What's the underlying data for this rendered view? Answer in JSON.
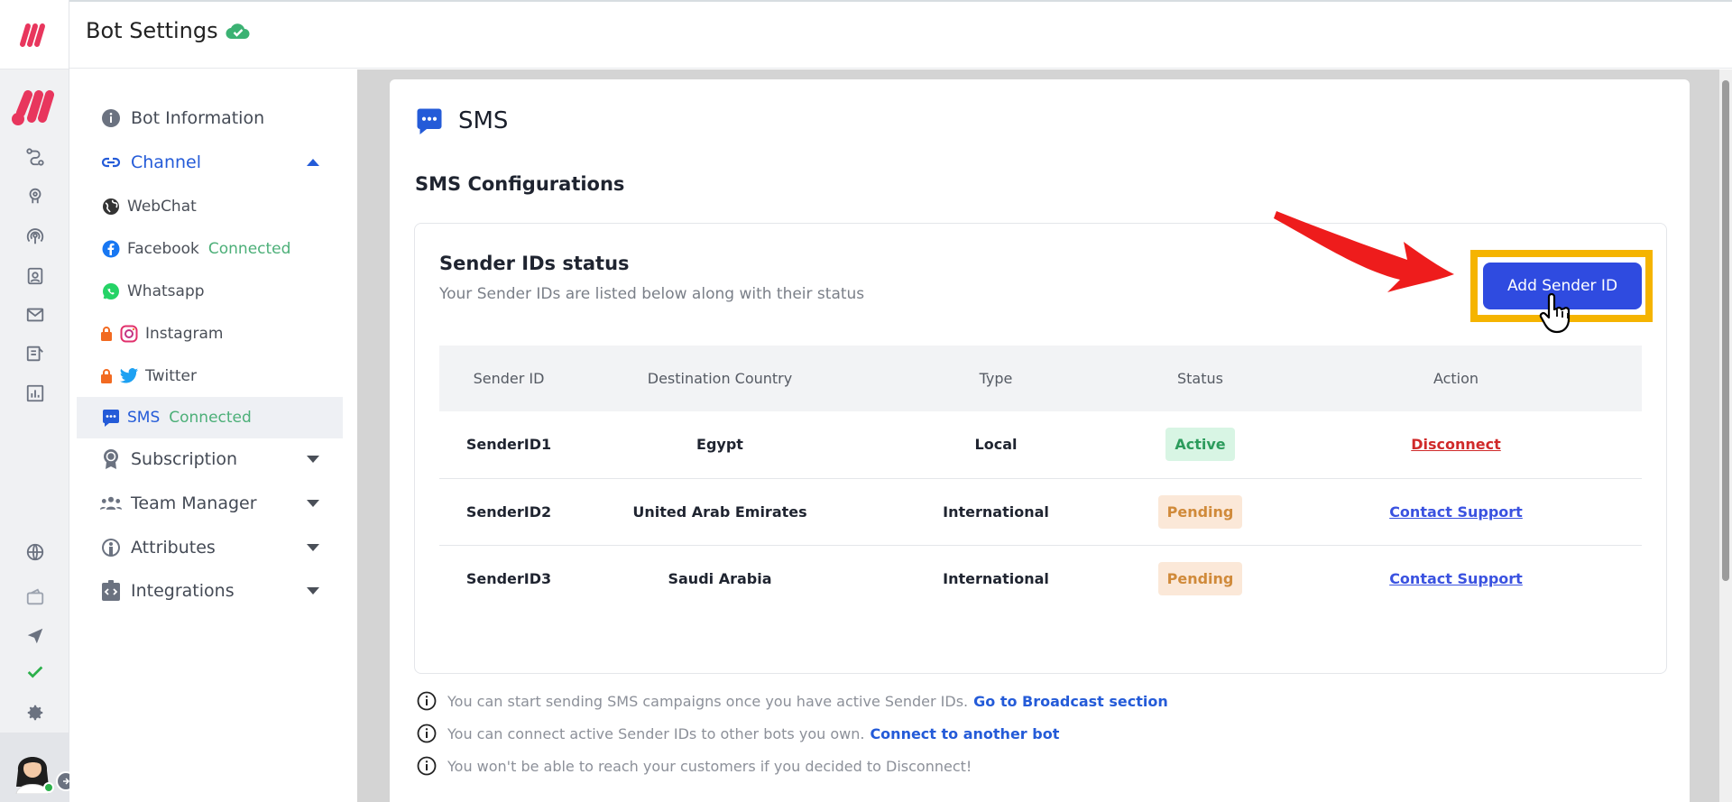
{
  "header": {
    "title": "Bot Settings",
    "saved_icon": "cloud-check-icon"
  },
  "settings_nav": {
    "bot_information": "Bot Information",
    "channel": "Channel",
    "channels": [
      {
        "label": "WebChat",
        "icon": "globe-icon",
        "status": ""
      },
      {
        "label": "Facebook",
        "icon": "facebook-icon",
        "status": "Connected"
      },
      {
        "label": "Whatsapp",
        "icon": "whatsapp-icon",
        "status": ""
      },
      {
        "label": "Instagram",
        "icon": "instagram-icon",
        "status": "",
        "locked": true
      },
      {
        "label": "Twitter",
        "icon": "twitter-icon",
        "status": "",
        "locked": true
      },
      {
        "label": "SMS",
        "icon": "sms-chat-icon",
        "status": "Connected",
        "active": true
      }
    ],
    "subscription": "Subscription",
    "team_manager": "Team Manager",
    "attributes": "Attributes",
    "integrations": "Integrations"
  },
  "card": {
    "title": "SMS",
    "section_title": "SMS Configurations",
    "panel": {
      "title": "Sender IDs status",
      "subtitle": "Your Sender IDs are listed below along with their status",
      "add_button": "Add Sender ID"
    },
    "table": {
      "headers": [
        "Sender ID",
        "Destination Country",
        "Type",
        "Status",
        "Action"
      ],
      "rows": [
        {
          "sender_id": "SenderID1",
          "country": "Egypt",
          "type": "Local",
          "status": "Active",
          "action": "Disconnect"
        },
        {
          "sender_id": "SenderID2",
          "country": "United Arab Emirates",
          "type": "International",
          "status": "Pending",
          "action": "Contact Support"
        },
        {
          "sender_id": "SenderID3",
          "country": "Saudi Arabia",
          "type": "International",
          "status": "Pending",
          "action": "Contact Support"
        }
      ]
    },
    "notes": [
      {
        "text": "You can start sending SMS campaigns once you have active Sender IDs.",
        "link": "Go to Broadcast section"
      },
      {
        "text": "You can connect active Sender IDs to other bots you own.",
        "link": "Connect to another bot"
      },
      {
        "text": "You won't be able to reach your customers if you decided to Disconnect!",
        "link": ""
      }
    ]
  },
  "colors": {
    "brand": "#e8365d",
    "primary": "#2f4be0",
    "highlight": "#f5b400",
    "connected": "#4caf78",
    "active_badge_bg": "#d8f5e4",
    "pending_badge_bg": "#fbe8d8"
  }
}
